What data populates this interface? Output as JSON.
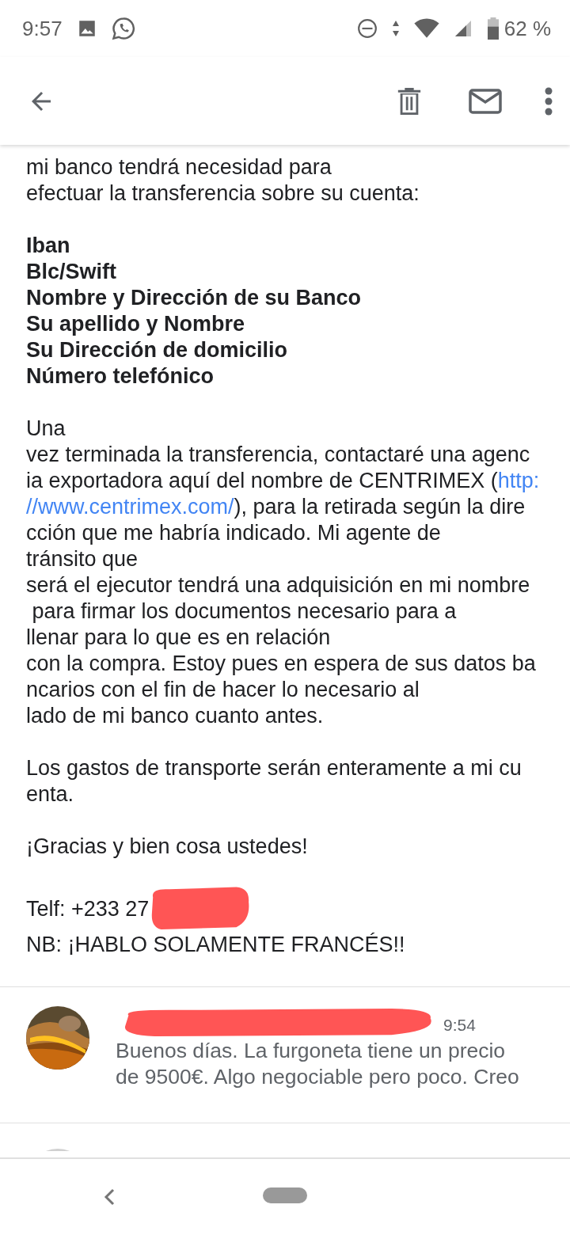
{
  "status_bar": {
    "time": "9:57",
    "battery": "62 %"
  },
  "email_body": [
    {
      "kind": "text",
      "lines": [
        "mi banco tendrá necesidad para",
        "efectuar la transferencia sobre su cuenta:"
      ]
    },
    {
      "kind": "bold",
      "lines": [
        "Iban",
        "Blc/Swift",
        "Nombre y Dirección de su Banco",
        "Su apellido y Nombre",
        "Su Dirección de domicilio",
        "Número telefónico"
      ]
    },
    {
      "kind": "text",
      "lines": [
        "Una",
        "vez terminada la transferencia, contactaré una agenc",
        [
          {
            "text": "ia exportadora aquí del nombre de CENTRIMEX (",
            "link": false
          },
          {
            "text": "http:",
            "link": true
          }
        ],
        [
          {
            "text": "//www.centrimex.com/",
            "link": true
          },
          {
            "text": "), para la retirada según la dire",
            "link": false
          }
        ],
        "cción que me habría indicado. Mi agente de",
        "tránsito que",
        "será el ejecutor tendrá una adquisición en mi nombre",
        " para firmar los documentos necesario para a",
        "llenar para lo que es en relación",
        "con la compra. Estoy pues en espera de sus datos ba",
        "ncarios con el fin de hacer lo necesario al",
        "lado de mi banco cuanto antes."
      ]
    },
    {
      "kind": "text",
      "lines": [
        "Los gastos de transporte serán enteramente a mi cu",
        "enta."
      ]
    },
    {
      "kind": "text",
      "lines": [
        "¡Gracias y bien cosa ustedes!"
      ]
    },
    {
      "kind": "redacted",
      "lines": [
        "Telf: +233 27",
        "NB: ¡HABLO SOLAMENTE FRANCÉS!!"
      ]
    }
  ],
  "messages": [
    {
      "kind": "picture",
      "time": "9:54",
      "preview": [
        "Buenos días. La furgoneta tiene un precio",
        "de 9500€. Algo negociable pero poco. Creo"
      ]
    }
  ]
}
